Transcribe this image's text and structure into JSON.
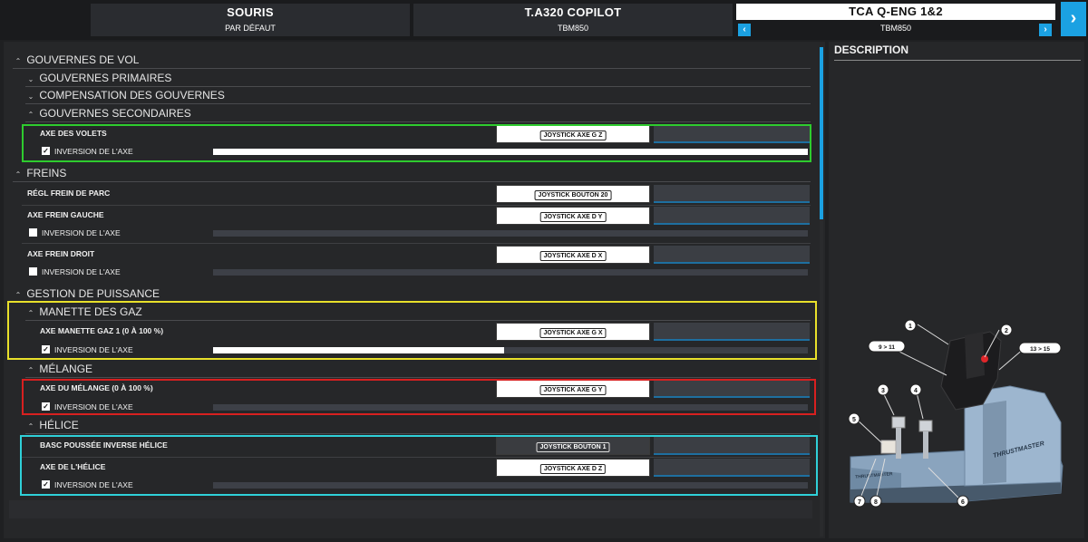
{
  "devices": [
    {
      "name": "SOURIS",
      "profile": "PAR DÉFAUT"
    },
    {
      "name": "T.A320 COPILOT",
      "profile": "TBM850"
    },
    {
      "name": "TCA Q-ENG 1&2",
      "profile": "TBM850"
    }
  ],
  "sections": {
    "flight_controls": "GOUVERNES DE VOL",
    "primary": "GOUVERNES PRIMAIRES",
    "trim": "COMPENSATION DES GOUVERNES",
    "secondary": "GOUVERNES SECONDAIRES",
    "brakes": "FREINS",
    "power": "GESTION DE PUISSANCE",
    "throttle": "MANETTE DES GAZ",
    "mixture": "MÉLANGE",
    "propeller": "HÉLICE"
  },
  "rows": {
    "flaps": {
      "label": "AXE DES VOLETS",
      "binding": "JOYSTICK AXE G Z"
    },
    "flaps_invert": {
      "label": "INVERSION DE L'AXE",
      "checked": true,
      "level": 1.0
    },
    "parking_brake": {
      "label": "RÉGL FREIN DE PARC",
      "binding": "JOYSTICK BOUTON 20"
    },
    "left_brake": {
      "label": "AXE FREIN GAUCHE",
      "binding": "JOYSTICK AXE D Y"
    },
    "left_brake_invert": {
      "label": "INVERSION DE L'AXE",
      "checked": false,
      "level": 0.0
    },
    "right_brake": {
      "label": "AXE FREIN DROIT",
      "binding": "JOYSTICK AXE D X"
    },
    "right_brake_invert": {
      "label": "INVERSION DE L'AXE",
      "checked": false,
      "level": 0.0
    },
    "throttle1": {
      "label": "AXE MANETTE GAZ 1 (0 À 100 %)",
      "binding": "JOYSTICK AXE G X"
    },
    "throttle1_invert": {
      "label": "INVERSION DE L'AXE",
      "checked": true,
      "level": 0.49
    },
    "mixture": {
      "label": "AXE DU MÉLANGE (0 À 100 %)",
      "binding": "JOYSTICK AXE G Y"
    },
    "mixture_invert": {
      "label": "INVERSION DE L'AXE",
      "checked": true,
      "level": 0.0
    },
    "reverse": {
      "label": "BASC POUSSÉE INVERSE HÉLICE",
      "binding": "JOYSTICK BOUTON 1"
    },
    "prop": {
      "label": "AXE DE L'HÉLICE",
      "binding": "JOYSTICK AXE D Z"
    },
    "prop_invert": {
      "label": "INVERSION DE L'AXE",
      "checked": true,
      "level": 0.0
    }
  },
  "description": {
    "title": "DESCRIPTION",
    "brand": "THRUSTMASTER",
    "callouts": [
      "1",
      "2",
      "3",
      "4",
      "5",
      "6",
      "7",
      "8",
      "9 > 11",
      "13 > 15"
    ]
  },
  "colors": {
    "accent": "#1ba1e2",
    "highlight_green": "#2ecc2e",
    "highlight_yellow": "#e8e02a",
    "highlight_red": "#d82020",
    "highlight_cyan": "#2fd0d8"
  }
}
